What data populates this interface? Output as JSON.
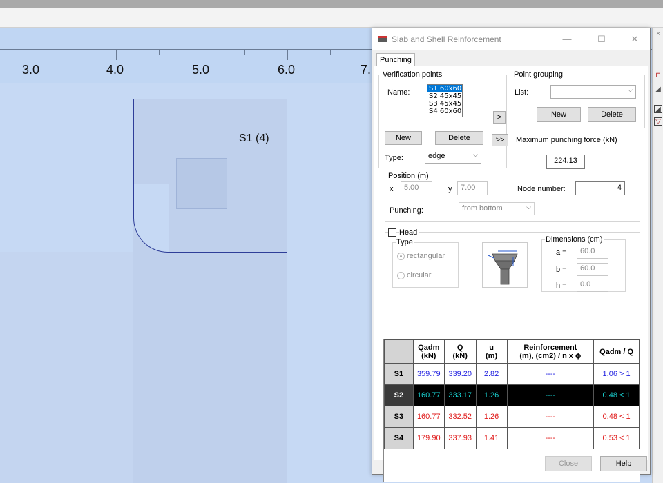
{
  "ruler": {
    "labels": [
      "3.0",
      "4.0",
      "5.0",
      "6.0",
      "7."
    ]
  },
  "canvas": {
    "slab_label": "S1 (4)"
  },
  "dialog": {
    "title": "Slab and Shell Reinforcement",
    "tab": "Punching",
    "verification": {
      "legend": "Verification points",
      "name_label": "Name:",
      "names": [
        "S1 60x60",
        "S2 45x45",
        "S3 45x45",
        "S4 60x60"
      ],
      "selected_index": 0,
      "add_label": ">",
      "add_all_label": ">>",
      "new_label": "New",
      "delete_label": "Delete",
      "type_label": "Type:",
      "type_value": "edge"
    },
    "grouping": {
      "legend": "Point grouping",
      "list_label": "List:",
      "list_value": "",
      "new_label": "New",
      "delete_label": "Delete",
      "max_force_label": "Maximum punching force (kN)",
      "max_force_value": "224.13"
    },
    "position": {
      "legend": "Position (m)",
      "x_label": "x",
      "x_value": "5.00",
      "y_label": "y",
      "y_value": "7.00",
      "node_label": "Node number:",
      "node_value": "4",
      "punching_label": "Punching:",
      "punching_value": "from bottom"
    },
    "head": {
      "label": "Head",
      "checked": false,
      "type_legend": "Type",
      "rect_label": "rectangular",
      "circ_label": "circular",
      "dims_legend": "Dimensions (cm)",
      "a_label": "a =",
      "a_value": "60.0",
      "b_label": "b =",
      "b_value": "60.0",
      "h_label": "h =",
      "h_value": "0.0"
    },
    "table": {
      "headers": [
        "",
        "Qadm\n(kN)",
        "Q\n(kN)",
        "u\n(m)",
        "Reinforcement\n(m), (cm2) / n x ϕ",
        "Qadm / Q"
      ],
      "rows": [
        {
          "id": "S1",
          "qadm": "359.79",
          "q": "339.20",
          "u": "2.82",
          "reinf": "----",
          "ratio": "1.06 > 1",
          "color": "#1f1fe0"
        },
        {
          "id": "S2",
          "qadm": "160.77",
          "q": "333.17",
          "u": "1.26",
          "reinf": "----",
          "ratio": "0.48 < 1",
          "color": "#19d3d3"
        },
        {
          "id": "S3",
          "qadm": "160.77",
          "q": "332.52",
          "u": "1.26",
          "reinf": "----",
          "ratio": "0.48 < 1",
          "color": "#e01919"
        },
        {
          "id": "S4",
          "qadm": "179.90",
          "q": "337.93",
          "u": "1.41",
          "reinf": "----",
          "ratio": "0.53 < 1",
          "color": "#e01919"
        }
      ],
      "selected_index": 1
    },
    "close_label": "Close",
    "help_label": "Help"
  }
}
